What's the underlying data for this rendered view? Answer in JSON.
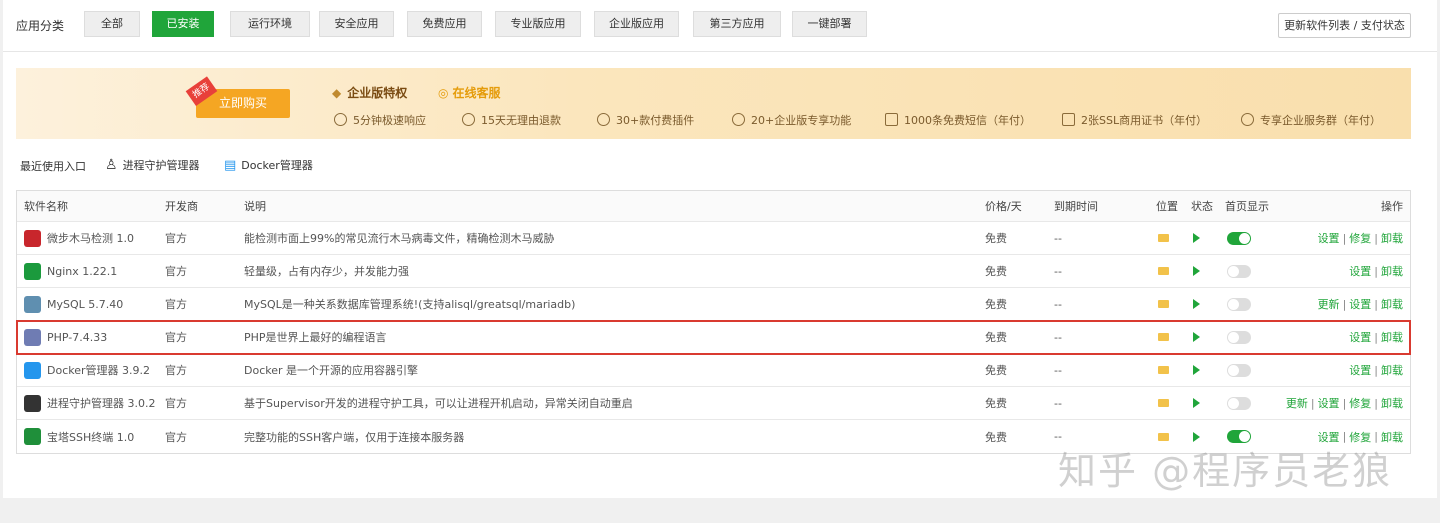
{
  "categories": {
    "label": "应用分类",
    "items": [
      "全部",
      "已安装",
      "运行环境",
      "安全应用",
      "免费应用",
      "专业版应用",
      "企业版应用",
      "第三方应用",
      "一键部署"
    ],
    "active_index": 1,
    "update_button": "更新软件列表 / 支付状态"
  },
  "banner": {
    "badge": "推荐",
    "buy_button": "立即购买",
    "title": "企业版特权",
    "service": "在线客服",
    "features": [
      "5分钟极速响应",
      "15天无理由退款",
      "30+款付费插件",
      "20+企业版专享功能",
      "1000条免费短信（年付）",
      "2张SSL商用证书（年付）",
      "专享企业服务群（年付）"
    ]
  },
  "recent": {
    "label": "最近使用入口",
    "items": [
      "进程守护管理器",
      "Docker管理器"
    ]
  },
  "table": {
    "headers": {
      "name": "软件名称",
      "dev": "开发商",
      "desc": "说明",
      "price": "价格/天",
      "expire": "到期时间",
      "location": "位置",
      "status": "状态",
      "home": "首页显示",
      "ops": "操作"
    },
    "rows": [
      {
        "name": "微步木马检测 1.0",
        "dev": "官方",
        "desc": "能检测市面上99%的常见流行木马病毒文件，精确检测木马威胁",
        "price": "免费",
        "expire": "--",
        "home_on": true,
        "ops": [
          "设置",
          "修复",
          "卸载"
        ],
        "icon": "weibu-shield-icon",
        "icon_color": "#c8262c"
      },
      {
        "name": "Nginx 1.22.1",
        "dev": "官方",
        "desc": "轻量级，占有内存少，并发能力强",
        "price": "免费",
        "expire": "--",
        "home_on": false,
        "ops": [
          "设置",
          "卸载"
        ],
        "icon": "nginx-icon",
        "icon_color": "#1b9a3d"
      },
      {
        "name": "MySQL 5.7.40",
        "dev": "官方",
        "desc": "MySQL是一种关系数据库管理系统!(支持alisql/greatsql/mariadb)",
        "price": "免费",
        "expire": "--",
        "home_on": false,
        "ops": [
          "更新",
          "设置",
          "卸载"
        ],
        "icon": "mysql-icon",
        "icon_color": "#5f8fb0"
      },
      {
        "name": "PHP-7.4.33",
        "dev": "官方",
        "desc": "PHP是世界上最好的编程语言",
        "price": "免费",
        "expire": "--",
        "home_on": false,
        "ops": [
          "设置",
          "卸载"
        ],
        "icon": "php-icon",
        "icon_color": "#6f7cb3"
      },
      {
        "name": "Docker管理器 3.9.2",
        "dev": "官方",
        "desc": "Docker 是一个开源的应用容器引擎",
        "price": "免费",
        "expire": "--",
        "home_on": false,
        "ops": [
          "设置",
          "卸载"
        ],
        "icon": "docker-icon",
        "icon_color": "#2496ed"
      },
      {
        "name": "进程守护管理器 3.0.2",
        "dev": "官方",
        "desc": "基于Supervisor开发的进程守护工具，可以让进程开机启动，异常关闭自动重启",
        "price": "免费",
        "expire": "--",
        "home_on": false,
        "ops": [
          "更新",
          "设置",
          "修复",
          "卸载"
        ],
        "icon": "penguin-icon",
        "icon_color": "#333333"
      },
      {
        "name": "宝塔SSH终端 1.0",
        "dev": "官方",
        "desc": "完整功能的SSH客户端，仅用于连接本服务器",
        "price": "免费",
        "expire": "--",
        "home_on": true,
        "ops": [
          "设置",
          "修复",
          "卸载"
        ],
        "icon": "terminal-icon",
        "icon_color": "#1f8f3a"
      }
    ],
    "highlighted_row": 3
  },
  "watermark": "知乎 @程序员老狼"
}
